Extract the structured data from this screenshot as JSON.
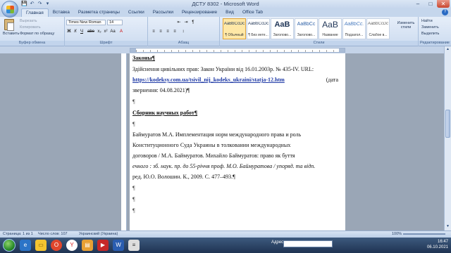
{
  "window": {
    "title": "ДСТУ 8302 - Microsoft Word",
    "qat": [
      "💾",
      "↶",
      "↷",
      "▾"
    ],
    "controls": {
      "minimize": "–",
      "maximize": "□",
      "close": "✕"
    }
  },
  "tabs": [
    "Главная",
    "Вставка",
    "Разметка страницы",
    "Ссылки",
    "Рассылки",
    "Рецензирование",
    "Вид",
    "Office Tab"
  ],
  "ribbon": {
    "clipboard": {
      "paste": "Вставить",
      "cut": "Вырезать",
      "copy": "Копировать",
      "format_painter": "Формат по образцу",
      "label": "Буфер обмена"
    },
    "font": {
      "name": "Times New Roman",
      "size": "14",
      "label": "Шрифт",
      "buttons": [
        "Ж",
        "К",
        "Ч",
        "abe",
        "x₂",
        "x²",
        "Aa",
        "A"
      ]
    },
    "paragraph": {
      "label": "Абзац",
      "buttons": [
        "≡",
        "≡",
        "≡",
        "≡",
        "¶",
        "↕",
        "⇤",
        "⇥"
      ]
    },
    "styles": {
      "label": "Стили",
      "tiles": [
        {
          "sample": "AaBbCcDc",
          "name": "¶ Обычный"
        },
        {
          "sample": "AaBbCcDc",
          "name": "¶ Без инте..."
        },
        {
          "sample": "AaB",
          "name": "Заголово..."
        },
        {
          "sample": "AaBbCc",
          "name": "Заголово..."
        },
        {
          "sample": "AaB",
          "name": "Название"
        },
        {
          "sample": "AaBbCc.",
          "name": "Подзагол..."
        },
        {
          "sample": "AaBbCcDc",
          "name": "Слабое в..."
        }
      ],
      "change_styles": "Изменить стили"
    },
    "editing": {
      "label": "Редактирование",
      "find": "Найти",
      "replace": "Заменить",
      "select": "Выделить"
    }
  },
  "document": {
    "heading1": "Законы¶",
    "line1": "Здійснення цивільних прав: Закон України від 16.01.2003р. № 435-IV. URL:",
    "link": "https://kodeksy.com.ua/tsivil_nij_kodeks_ukraini/statja-12.htm",
    "line2b": "(дата",
    "line3": "звернення: 04.08.2021)¶",
    "pilcrow": "¶",
    "heading2": "Сборник научных работ¶",
    "line4": "Баймуратов М.А. Имплементация норм международного права и роль",
    "line5": "Конституционного Суда Украины в толковании международных",
    "line6": "договоров / М.А. Баймуратов. Михайло Баймуратов: право як буття",
    "line7": "ечного : зб. наук. пр. до 55-річчя проф. М.О. Баймуратова / упоряд. та відп.",
    "line8": "ред. Ю.О. Волошин. К., 2009. С. 477–493.¶"
  },
  "status": {
    "page": "Страница: 1 из 1",
    "words": "Число слов: 107",
    "language": "Украинский (Украина)",
    "zoom": "100%"
  },
  "taskbar": {
    "address_label": "Адрес",
    "time": "16:47",
    "date": "06.10.2021"
  },
  "colors": {
    "accent": "#2a6bc4",
    "link": "#1f3aa6",
    "ribbon": "#cddcf0"
  }
}
